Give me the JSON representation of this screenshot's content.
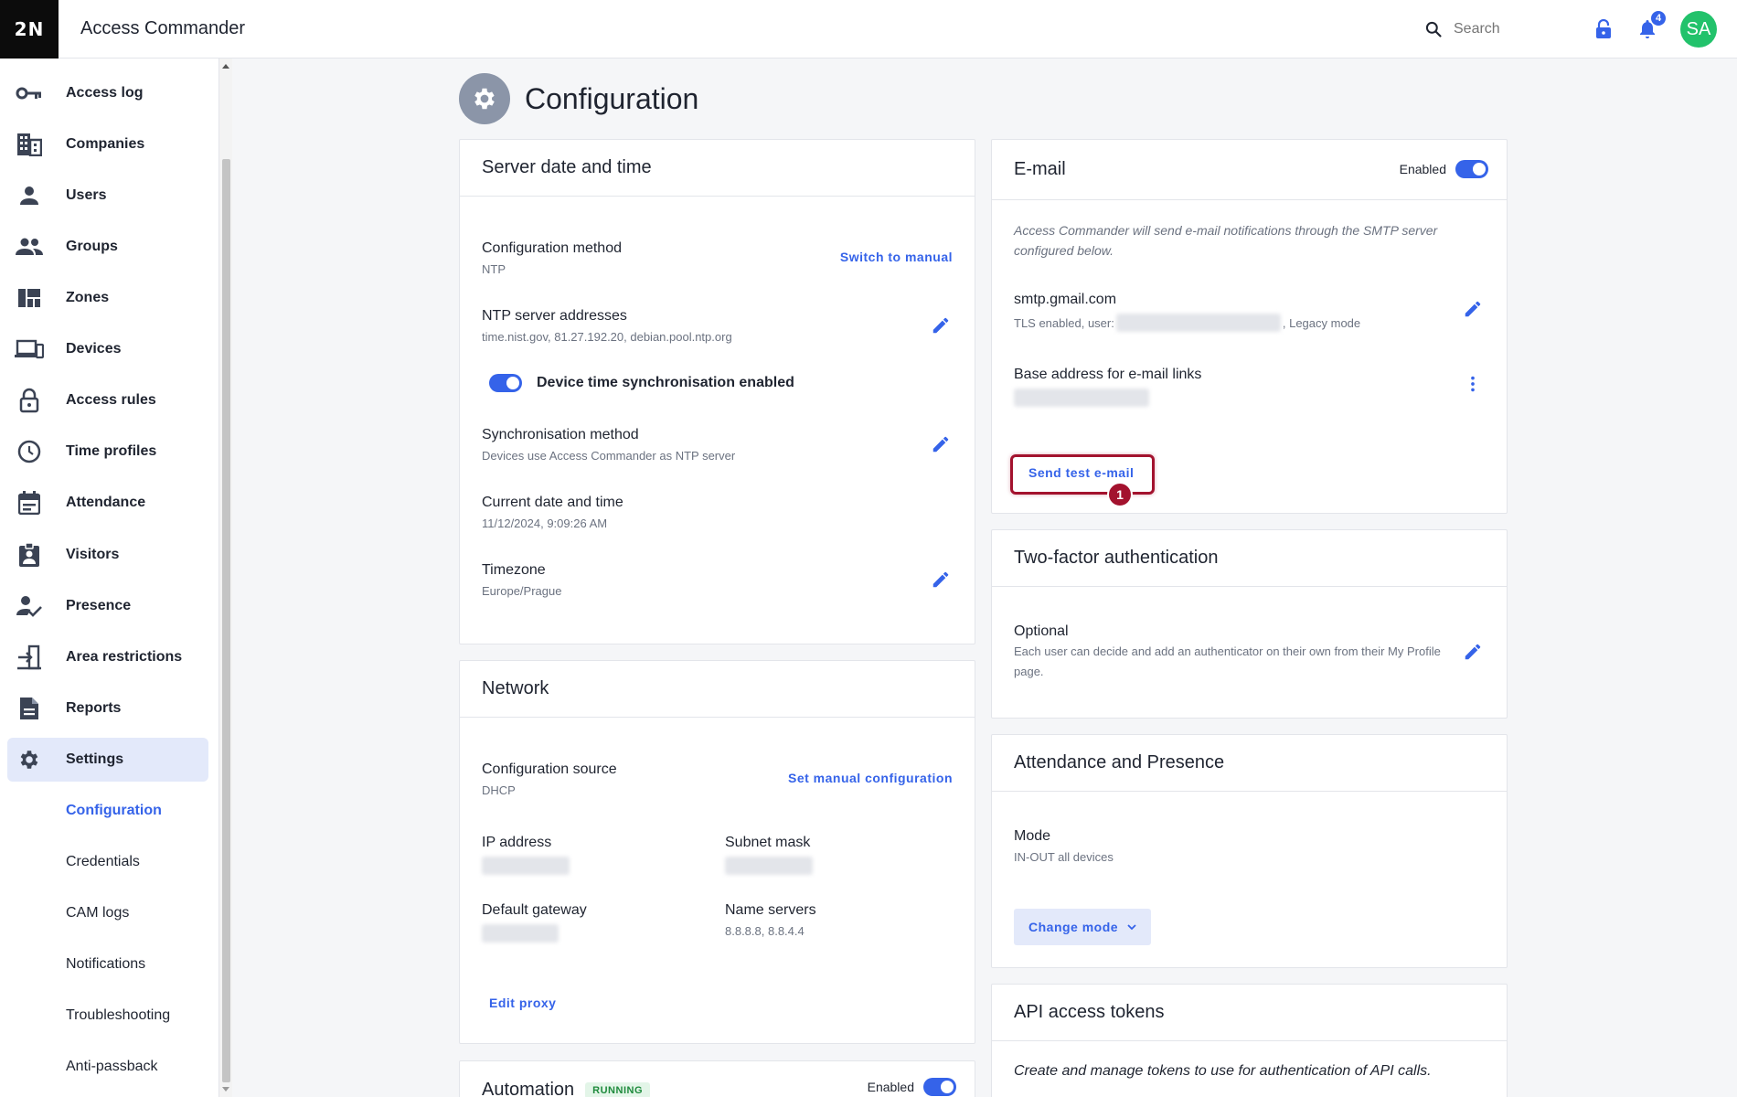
{
  "header": {
    "logo": "2N",
    "app_title": "Access Commander",
    "search_placeholder": "Search",
    "notifications_count": "4",
    "avatar_initials": "SA"
  },
  "sidebar": {
    "items": [
      {
        "label": "Access log",
        "icon": "key-icon"
      },
      {
        "label": "Companies",
        "icon": "building-icon"
      },
      {
        "label": "Users",
        "icon": "user-icon"
      },
      {
        "label": "Groups",
        "icon": "group-icon"
      },
      {
        "label": "Zones",
        "icon": "zones-icon"
      },
      {
        "label": "Devices",
        "icon": "devices-icon"
      },
      {
        "label": "Access rules",
        "icon": "lock-icon"
      },
      {
        "label": "Time profiles",
        "icon": "clock-icon"
      },
      {
        "label": "Attendance",
        "icon": "calendar-icon"
      },
      {
        "label": "Visitors",
        "icon": "visitor-badge-icon"
      },
      {
        "label": "Presence",
        "icon": "user-check-icon"
      },
      {
        "label": "Area restrictions",
        "icon": "area-restriction-icon"
      },
      {
        "label": "Reports",
        "icon": "report-icon"
      },
      {
        "label": "Settings",
        "icon": "gear-icon"
      }
    ],
    "sub_items": [
      "Configuration",
      "Credentials",
      "CAM logs",
      "Notifications",
      "Troubleshooting",
      "Anti-passback"
    ]
  },
  "page": {
    "title": "Configuration"
  },
  "server_time": {
    "title": "Server date and time",
    "config_method_label": "Configuration method",
    "config_method_value": "NTP",
    "switch_manual": "Switch to manual",
    "ntp_label": "NTP server addresses",
    "ntp_value": "time.nist.gov, 81.27.192.20, debian.pool.ntp.org",
    "sync_toggle_label": "Device time synchronisation enabled",
    "sync_method_label": "Synchronisation method",
    "sync_method_value": "Devices use Access Commander as NTP server",
    "current_label": "Current date and time",
    "current_value": "11/12/2024, 9:09:26 AM",
    "timezone_label": "Timezone",
    "timezone_value": "Europe/Prague"
  },
  "network": {
    "title": "Network",
    "source_label": "Configuration source",
    "source_value": "DHCP",
    "set_manual": "Set manual configuration",
    "ip_label": "IP address",
    "subnet_label": "Subnet mask",
    "gateway_label": "Default gateway",
    "dns_label": "Name servers",
    "dns_value": "8.8.8.8, 8.8.4.4",
    "edit_proxy": "Edit proxy"
  },
  "automation": {
    "title": "Automation",
    "status": "RUNNING",
    "enabled_label": "Enabled"
  },
  "email": {
    "title": "E-mail",
    "enabled_label": "Enabled",
    "note": "Access Commander will send e-mail notifications through the SMTP server configured below.",
    "smtp_host": "smtp.gmail.com",
    "smtp_details_prefix": "TLS enabled, user:",
    "smtp_details_suffix": ", Legacy mode",
    "base_address_label": "Base address for e-mail links",
    "send_test": "Send test e-mail",
    "step_marker": "1"
  },
  "two_factor": {
    "title": "Two-factor authentication",
    "mode_label": "Optional",
    "mode_desc": "Each user can decide and add an authenticator on their own from their My Profile page."
  },
  "attendance": {
    "title": "Attendance and Presence",
    "mode_label": "Mode",
    "mode_value": "IN-OUT all devices",
    "change_mode": "Change mode"
  },
  "api_tokens": {
    "title": "API access tokens",
    "desc": "Create and manage tokens to use for authentication of API calls."
  },
  "colors": {
    "accent": "#3563e9",
    "highlight_ring": "#a3122e",
    "avatar": "#22c26b",
    "running_badge": "#1e8a3c"
  }
}
